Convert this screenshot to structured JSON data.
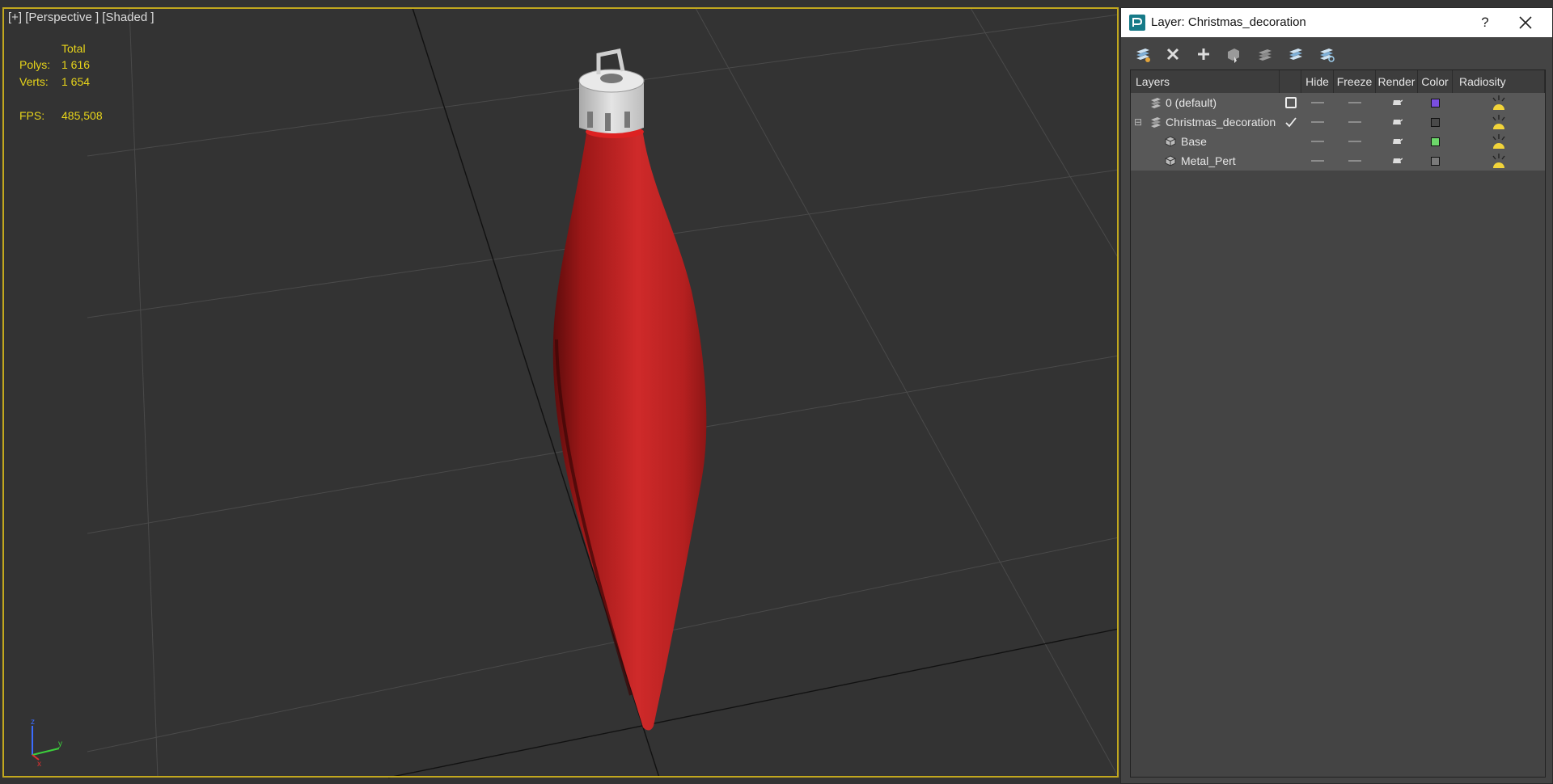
{
  "viewport": {
    "label": "[+] [Perspective ] [Shaded ]",
    "stats": {
      "total_label": "Total",
      "polys_label": "Polys:",
      "polys_value": "1 616",
      "verts_label": "Verts:",
      "verts_value": "1 654",
      "fps_label": "FPS:",
      "fps_value": "485,508"
    },
    "axes": {
      "z": "z",
      "y": "y",
      "x": "x"
    }
  },
  "dialog": {
    "title": "Layer: Christmas_decoration",
    "help": "?",
    "toolbar_icons": [
      "create-layer-icon",
      "delete-layer-icon",
      "add-selected-icon",
      "select-objects-icon",
      "highlight-layer-icon",
      "hide-all-icon",
      "freeze-all-icon"
    ],
    "columns": {
      "layers": "Layers",
      "hide": "Hide",
      "freeze": "Freeze",
      "render": "Render",
      "color": "Color",
      "radiosity": "Radiosity"
    },
    "rows": [
      {
        "name": "0 (default)",
        "type": "layer",
        "active_mark": "box",
        "color": "#7a4ee0"
      },
      {
        "name": "Christmas_decoration",
        "type": "layer",
        "expander": "⊟",
        "active_mark": "check",
        "color": "#4a4a4a"
      },
      {
        "name": "Base",
        "type": "object",
        "color": "#6dd86a"
      },
      {
        "name": "Metal_Pert",
        "type": "object",
        "color": "#7a7a7a"
      }
    ]
  }
}
